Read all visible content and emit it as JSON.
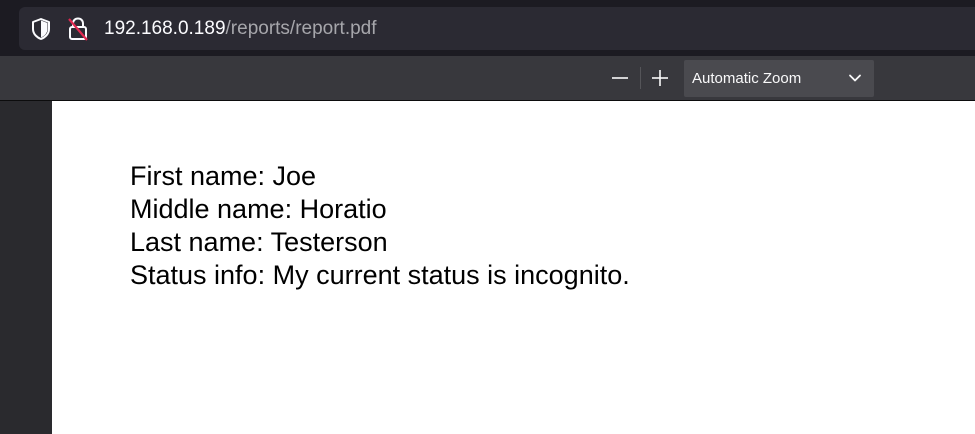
{
  "address_bar": {
    "url_host": "192.168.0.189",
    "url_path": "/reports/report.pdf",
    "shield_icon": "shield-icon",
    "lock_icon": "insecure-lock-icon"
  },
  "pdf_toolbar": {
    "zoom_out_icon": "minus-icon",
    "zoom_in_icon": "plus-icon",
    "zoom_value": "Automatic Zoom",
    "dropdown_icon": "chevron-down-icon"
  },
  "document": {
    "lines": [
      "First name: Joe",
      "Middle name: Horatio",
      "Last name: Testerson",
      "Status info: My current status is incognito."
    ]
  },
  "colors": {
    "toolbar_bg": "#38383d",
    "urlbar_bg": "#2b2a33",
    "page_bg": "#ffffff",
    "insecure_slash": "#e22850"
  }
}
